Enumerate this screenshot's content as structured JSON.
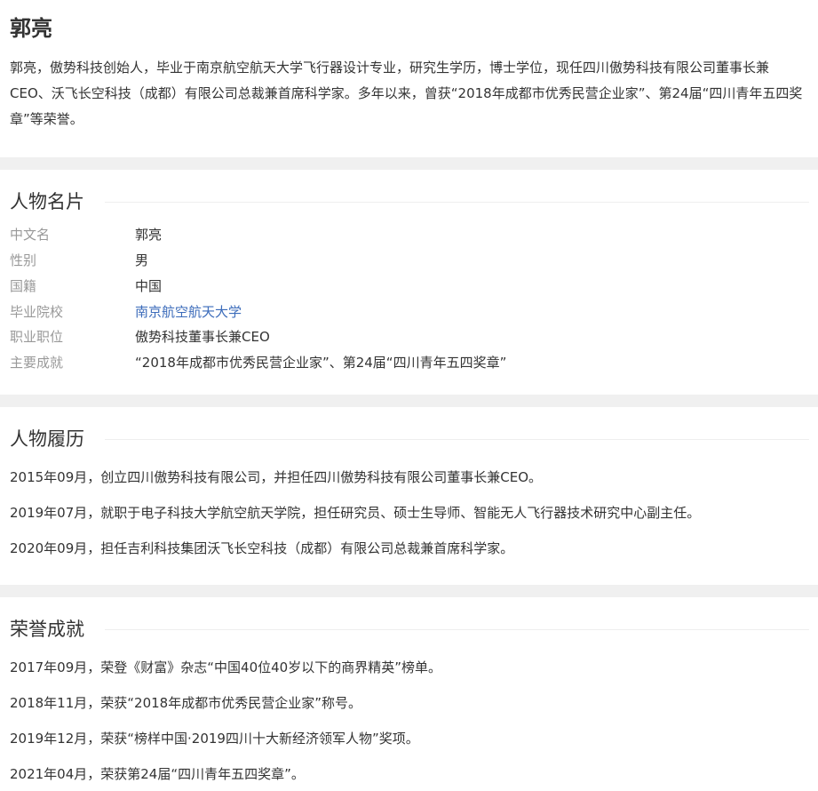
{
  "person": {
    "name": "郭亮",
    "summary": "郭亮，傲势科技创始人，毕业于南京航空航天大学飞行器设计专业，研究生学历，博士学位，现任四川傲势科技有限公司董事长兼CEO、沃飞长空科技（成都）有限公司总裁兼首席科学家。多年以来，曾获“2018年成都市优秀民营企业家”、第24届“四川青年五四奖章”等荣誉。"
  },
  "card": {
    "title": "人物名片",
    "rows": [
      {
        "key": "中文名",
        "value": "郭亮"
      },
      {
        "key": "性别",
        "value": "男"
      },
      {
        "key": "国籍",
        "value": "中国"
      },
      {
        "key": "毕业院校",
        "value": "南京航空航天大学"
      },
      {
        "key": "职业职位",
        "value": "傲势科技董事长兼CEO"
      },
      {
        "key": "主要成就",
        "value": "“2018年成都市优秀民营企业家”、第24届“四川青年五四奖章”"
      }
    ]
  },
  "career": {
    "title": "人物履历",
    "items": [
      "2015年09月，创立四川傲势科技有限公司，并担任四川傲势科技有限公司董事长兼CEO。",
      "2019年07月，就职于电子科技大学航空航天学院，担任研究员、硕士生导师、智能无人飞行器技术研究中心副主任。",
      "2020年09月，担任吉利科技集团沃飞长空科技（成都）有限公司总裁兼首席科学家。"
    ]
  },
  "honors": {
    "title": "荣誉成就",
    "items": [
      "2017年09月，荣登《财富》杂志“中国40位40岁以下的商界精英”榜单。",
      "2018年11月，荣获“2018年成都市优秀民营企业家”称号。",
      "2019年12月，荣获“榜样中国·2019四川十大新经济领军人物”奖项。",
      "2021年04月，荣获第24届“四川青年五四奖章”。"
    ]
  },
  "colors": {
    "text": "#333333",
    "label": "#999999",
    "link": "#3B6BBA",
    "band": "#f0f0f0"
  }
}
